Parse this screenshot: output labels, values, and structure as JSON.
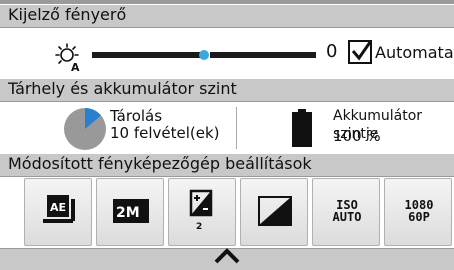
{
  "brightness": {
    "header": "Kijelző fényerő",
    "value": "0",
    "level": 0.5,
    "auto_label": "Automata",
    "auto_checked": true,
    "icon": "auto-brightness-icon"
  },
  "storage": {
    "header": "Tárhely és akkumulátor szint",
    "storage_label": "Tárolás",
    "storage_count": "10   felvétel(ek)",
    "storage_icon": "storage-pie-icon",
    "battery_label": "Akkumulátor szintje",
    "battery_value": "100 %",
    "battery_icon": "battery-full-icon"
  },
  "settings": {
    "header": "Módosított fényképezőgép beállítások",
    "tiles": [
      {
        "name": "ae-metering-icon",
        "label": "AE"
      },
      {
        "name": "image-size-icon",
        "label": "2M"
      },
      {
        "name": "exposure-compensation-icon",
        "label": "2"
      },
      {
        "name": "contrast-icon",
        "label": ""
      },
      {
        "name": "iso-auto-icon",
        "label": "ISO AUTO"
      },
      {
        "name": "video-1080-60p-icon",
        "label": "1080 60P"
      }
    ],
    "collapse_icon": "chevron-up-icon"
  },
  "colors": {
    "header_bg": "#c8c8c8",
    "accent": "#3aa8e0"
  }
}
